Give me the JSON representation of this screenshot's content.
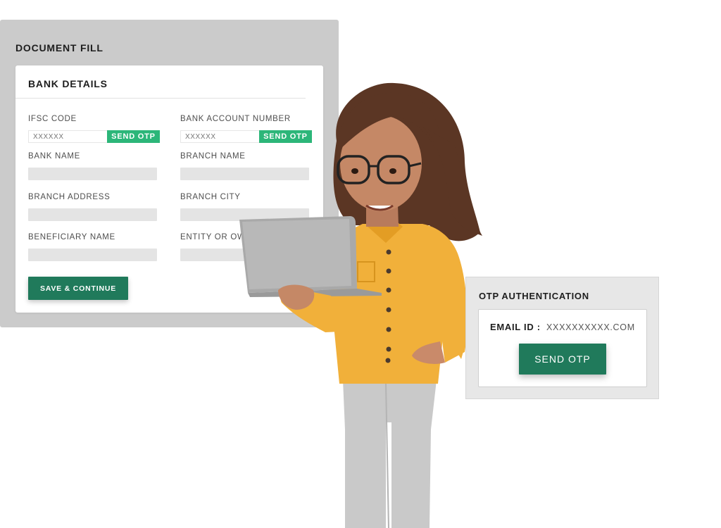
{
  "document_fill": {
    "title": "DOCUMENT FILL",
    "bank_details": {
      "title": "BANK DETAILS",
      "fields": {
        "ifsc_label": "IFSC CODE",
        "ifsc_placeholder": "XXXXXX",
        "ifsc_send_otp": "SEND OTP",
        "account_label": "BANK ACCOUNT NUMBER",
        "account_placeholder": "XXXXXX",
        "account_send_otp": "SEND OTP",
        "bank_name_label": "BANK NAME",
        "branch_name_label": "BRANCH NAME",
        "branch_address_label": "BRANCH ADDRESS",
        "branch_city_label": "BRANCH CITY",
        "beneficiary_label": "BENEFICIARY NAME",
        "entity_label": "ENTITY OR OW"
      },
      "save_button": "SAVE & CONTINUE"
    }
  },
  "otp_authentication": {
    "title": "OTP AUTHENTICATION",
    "email_label": "EMAIL ID :",
    "email_value": "XXXXXXXXXX.COM",
    "send_button": "SEND OTP"
  },
  "colors": {
    "primary_button": "#207a5b",
    "accent_otp": "#2cb679",
    "panel_gray": "#cbcbcb",
    "shirt": "#f2b43c"
  },
  "illustration": {
    "subject": "woman-with-laptop",
    "icon": "woman-holding-laptop-icon"
  }
}
